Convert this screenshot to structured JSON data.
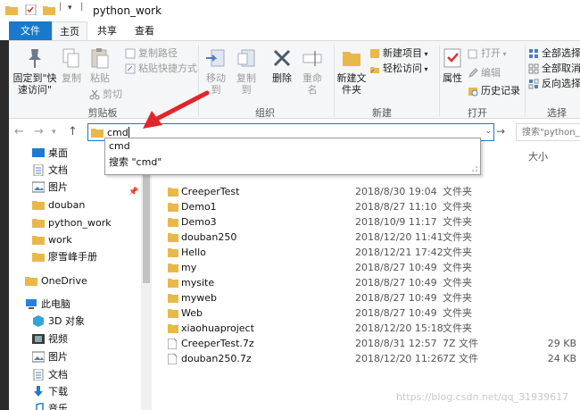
{
  "window": {
    "title": "python_work"
  },
  "tabs": [
    {
      "label": "文件"
    },
    {
      "label": "主页"
    },
    {
      "label": "共享"
    },
    {
      "label": "查看"
    }
  ],
  "ribbon": {
    "clipboard": {
      "label": "剪贴板",
      "pin_label": "固定到\"快速访问\"",
      "copy_label": "复制",
      "paste_label": "粘贴",
      "copy_path": "复制路径",
      "paste_shortcut": "粘贴快捷方式",
      "cut": "剪切"
    },
    "organize": {
      "label": "组织",
      "move_to": "移动到",
      "copy_to": "复制到",
      "delete": "删除",
      "rename": "重命名"
    },
    "new": {
      "label": "新建",
      "new_folder": "新建文件夹",
      "new_item": "新建项目",
      "easy_access": "轻松访问"
    },
    "open": {
      "label": "打开",
      "properties": "属性",
      "open": "打开",
      "edit": "编辑",
      "history": "历史记录"
    },
    "select": {
      "label": "选择",
      "select_all": "全部选择",
      "select_none": "全部取消",
      "invert": "反向选择"
    }
  },
  "address": {
    "value": "cmd",
    "suggestions": [
      "cmd",
      "搜索 \"cmd\""
    ]
  },
  "search": {
    "placeholder": "搜索\"python_w"
  },
  "navpane": {
    "quick": [
      {
        "label": "桌面"
      },
      {
        "label": "文档"
      },
      {
        "label": "图片"
      },
      {
        "label": "douban"
      },
      {
        "label": "python_work"
      },
      {
        "label": "work"
      },
      {
        "label": "廖雪峰手册"
      }
    ],
    "onedrive": "OneDrive",
    "thispc": "此电脑",
    "pc_items": [
      {
        "label": "3D 对象"
      },
      {
        "label": "视频"
      },
      {
        "label": "图片"
      },
      {
        "label": "文档"
      },
      {
        "label": "下载"
      },
      {
        "label": "音乐"
      }
    ]
  },
  "filelist": {
    "size_header": "大小",
    "rows": [
      {
        "name": "CreeperTest",
        "date": "2018/8/30 19:04",
        "type": "文件夹",
        "size": "",
        "kind": "folder"
      },
      {
        "name": "Demo1",
        "date": "2018/8/27 11:10",
        "type": "文件夹",
        "size": "",
        "kind": "folder"
      },
      {
        "name": "Demo3",
        "date": "2018/10/9 11:17",
        "type": "文件夹",
        "size": "",
        "kind": "folder"
      },
      {
        "name": "douban250",
        "date": "2018/12/20 11:41",
        "type": "文件夹",
        "size": "",
        "kind": "folder"
      },
      {
        "name": "Hello",
        "date": "2018/12/21 17:42",
        "type": "文件夹",
        "size": "",
        "kind": "folder"
      },
      {
        "name": "my",
        "date": "2018/8/27 10:49",
        "type": "文件夹",
        "size": "",
        "kind": "folder"
      },
      {
        "name": "mysite",
        "date": "2018/8/27 10:49",
        "type": "文件夹",
        "size": "",
        "kind": "folder"
      },
      {
        "name": "myweb",
        "date": "2018/8/27 10:49",
        "type": "文件夹",
        "size": "",
        "kind": "folder"
      },
      {
        "name": "Web",
        "date": "2018/8/27 10:49",
        "type": "文件夹",
        "size": "",
        "kind": "folder"
      },
      {
        "name": "xiaohuaproject",
        "date": "2018/12/20 15:18",
        "type": "文件夹",
        "size": "",
        "kind": "folder"
      },
      {
        "name": "CreeperTest.7z",
        "date": "2018/8/31 12:57",
        "type": "7Z 文件",
        "size": "29 KB",
        "kind": "file"
      },
      {
        "name": "douban250.7z",
        "date": "2018/12/20 11:26",
        "type": "7Z 文件",
        "size": "24 KB",
        "kind": "file"
      }
    ]
  },
  "watermark": "https://blog.csdn.net/qq_31939617",
  "colors": {
    "accent": "#1979ca",
    "folder": "#e8b84a",
    "arrow": "#e0262b"
  }
}
